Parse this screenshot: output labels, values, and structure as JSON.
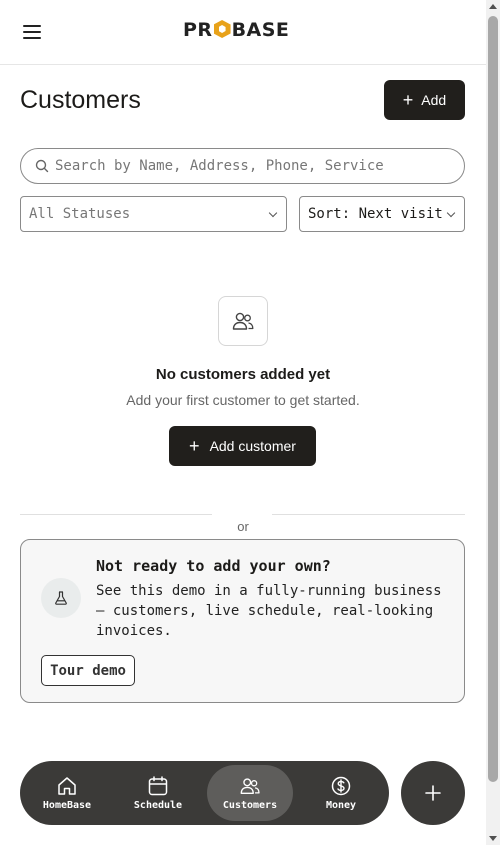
{
  "header": {
    "logo_text_left": "PR",
    "logo_text_right": "BASE",
    "menu_icon": "hamburger-menu-icon"
  },
  "page": {
    "title": "Customers",
    "add_label": "Add"
  },
  "search": {
    "placeholder": "Search by Name, Address, Phone, Service",
    "icon": "search-icon"
  },
  "filters": {
    "status_value": "All Statuses",
    "sort_value": "Sort: Next visit"
  },
  "empty_state": {
    "icon": "users-icon",
    "title": "No customers added yet",
    "subtitle": "Add your first customer to get started.",
    "button_label": "Add customer"
  },
  "separator": {
    "text": "or"
  },
  "demo": {
    "icon": "flask-icon",
    "title": "Not ready to add your own?",
    "description": "See this demo in a fully-running business — customers, live schedule, real-looking invoices.",
    "button_label": "Tour demo"
  },
  "nav": {
    "items": [
      {
        "label": "HomeBase",
        "icon": "home-icon",
        "active": false
      },
      {
        "label": "Schedule",
        "icon": "calendar-icon",
        "active": false
      },
      {
        "label": "Customers",
        "icon": "users-icon",
        "active": true
      },
      {
        "label": "Money",
        "icon": "dollar-icon",
        "active": false
      }
    ],
    "fab_icon": "plus-icon"
  },
  "colors": {
    "primary_dark": "#211f1c",
    "nav_bg": "#3b3a38",
    "nav_active": "#5e5d5b",
    "logo_accent": "#e8a21a"
  }
}
